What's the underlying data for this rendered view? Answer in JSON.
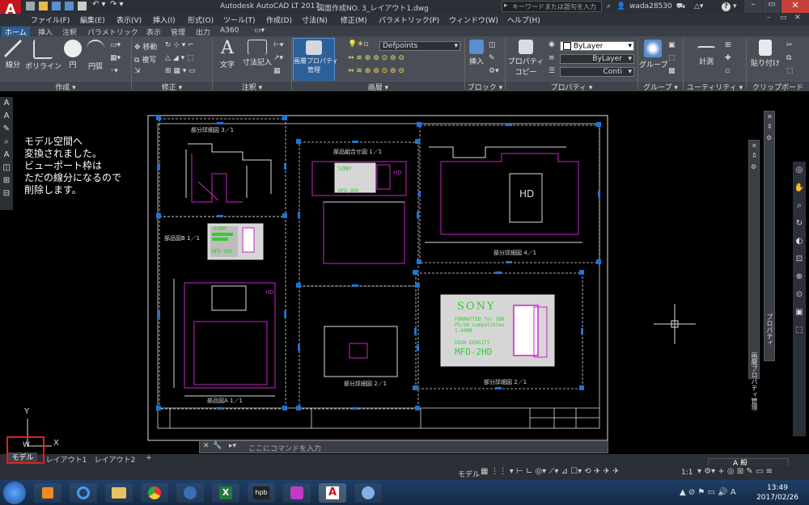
{
  "title_bar": {
    "app_title": "Autodesk AutoCAD LT 2017",
    "file_title": "図面作成NO. 3_レイアウト1.dwg",
    "search_placeholder": "キーワードまたは語句を入力",
    "user": "wada28530"
  },
  "menu": [
    "ファイル(F)",
    "編集(E)",
    "表示(V)",
    "挿入(I)",
    "形式(O)",
    "ツール(T)",
    "作成(D)",
    "寸法(N)",
    "修正(M)",
    "パラメトリック(P)",
    "ウィンドウ(W)",
    "ヘルプ(H)"
  ],
  "ribbon_tabs": [
    "ホーム",
    "挿入",
    "注釈",
    "パラメトリック",
    "表示",
    "管理",
    "出力",
    "A360"
  ],
  "ribbon": {
    "draw": {
      "line": "線分",
      "polyline": "ポリライン",
      "circle": "円",
      "arc": "円弧"
    },
    "modify": {
      "move": "移動",
      "copy": "複写"
    },
    "annotation": {
      "text": "文字",
      "dimension": "寸法記入"
    },
    "layer": {
      "props_line1": "画層プロパティ",
      "props_line2": "管理",
      "current_layer": "Defpoints"
    },
    "block": {
      "insert": "挿入"
    },
    "properties": {
      "copy_line1": "プロパティ",
      "copy_line2": "コピー",
      "color": "ByLayer",
      "linetype": "ByLayer",
      "lineweight": "Conti"
    },
    "group": {
      "label": "グループ"
    },
    "utility": {
      "measure": "計測"
    },
    "clipboard": {
      "paste": "貼り付け"
    }
  },
  "ribbon_groups": [
    "作成 ▾",
    "修正 ▾",
    "注釈 ▾",
    "画層 ▾",
    "ブロック ▾",
    "プロパティ ▾",
    "グループ ▾",
    "ユーティリティ ▾",
    "クリップボード"
  ],
  "annotation_note": [
    "モデル空間へ",
    "変換されました。",
    "ビューポート枠は",
    "ただの線分になるので",
    "削除します。"
  ],
  "drawing_labels": {
    "detail3": "部分詳細図 3／1",
    "assembly": "部品組合せ図 1／1",
    "partB": "部品図B 1／1",
    "detail4": "部分詳細図 4／1",
    "partA": "部品図A 1／1",
    "detail2a": "部分詳細図 2／1",
    "detail2b": "部分詳細図 2／1",
    "sony": "SONY",
    "formatted": "FORMATTED for IBM",
    "compat": "PS/2A compatibles",
    "cap": "1.44MB",
    "hd": "HIGH DENSITY",
    "model": "MFD-2HD",
    "hd_mark": "HD"
  },
  "panels": {
    "layer_props": "画層プロパティ管理",
    "properties": "プロパティ"
  },
  "ucs": {
    "y": "Y",
    "w": "W",
    "x": "X"
  },
  "command_placeholder": "ここにコマンドを入力",
  "layout_tabs": [
    "モデル",
    "レイアウト1",
    "レイアウト2",
    "+"
  ],
  "status": {
    "model": "モデル",
    "scale": "1:1"
  },
  "ime": {
    "mode": "A 般"
  },
  "clock": {
    "time": "13:49",
    "date": "2017/02/26"
  },
  "taskbar_apps": [
    "start",
    "media-player",
    "internet-explorer",
    "explorer",
    "chrome",
    "thunderbird",
    "excel",
    "hpb",
    "paint-app",
    "autocad",
    "paint"
  ]
}
